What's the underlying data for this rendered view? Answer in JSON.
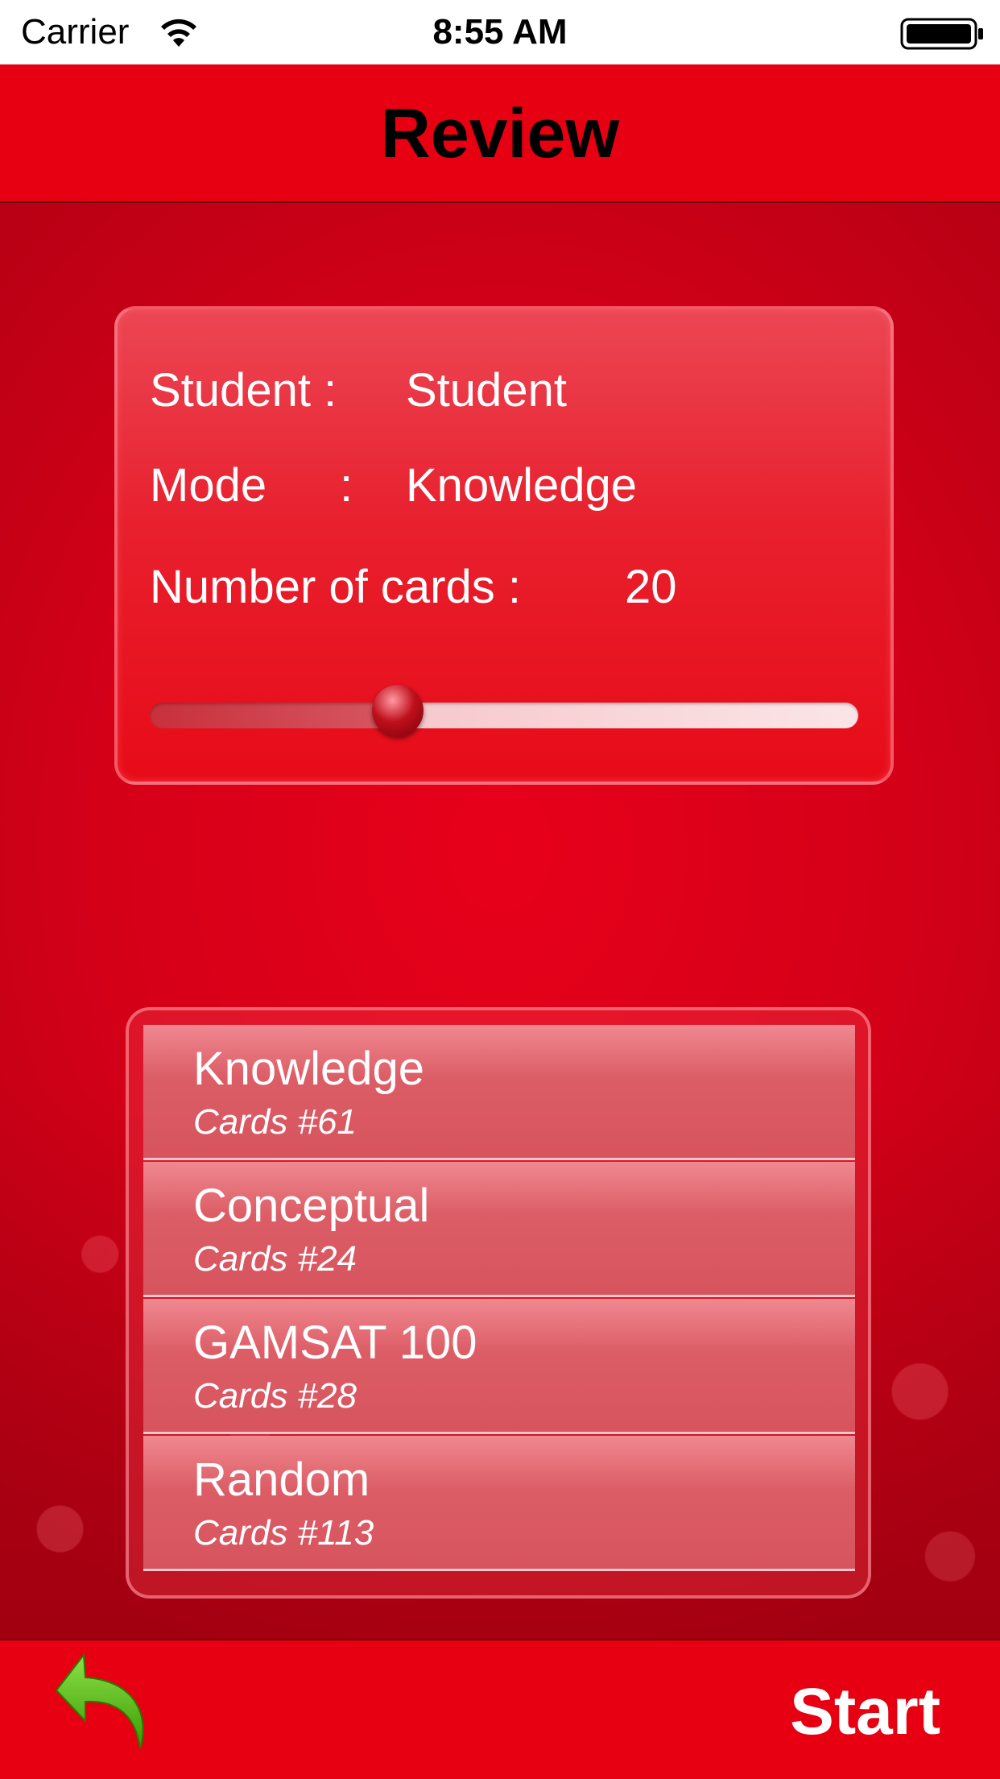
{
  "status_bar": {
    "carrier": "Carrier",
    "time": "8:55 AM"
  },
  "header": {
    "title": "Review"
  },
  "info": {
    "student_label": "Student :",
    "student_value": "Student",
    "mode_label": "Mode",
    "mode_colon": ":",
    "mode_value": "Knowledge",
    "cards_label": "Number of cards :",
    "cards_value": "20",
    "slider_fraction": 0.35
  },
  "modes": [
    {
      "title": "Knowledge",
      "subtitle": "Cards #61"
    },
    {
      "title": "Conceptual",
      "subtitle": "Cards #24"
    },
    {
      "title": "GAMSAT 100",
      "subtitle": "Cards #28"
    },
    {
      "title": "Random",
      "subtitle": "Cards #113"
    }
  ],
  "footer": {
    "start_label": "Start",
    "back_icon": "back-arrow-icon"
  },
  "colors": {
    "primary_red": "#e60012",
    "back_arrow_green": "#4cb400"
  }
}
